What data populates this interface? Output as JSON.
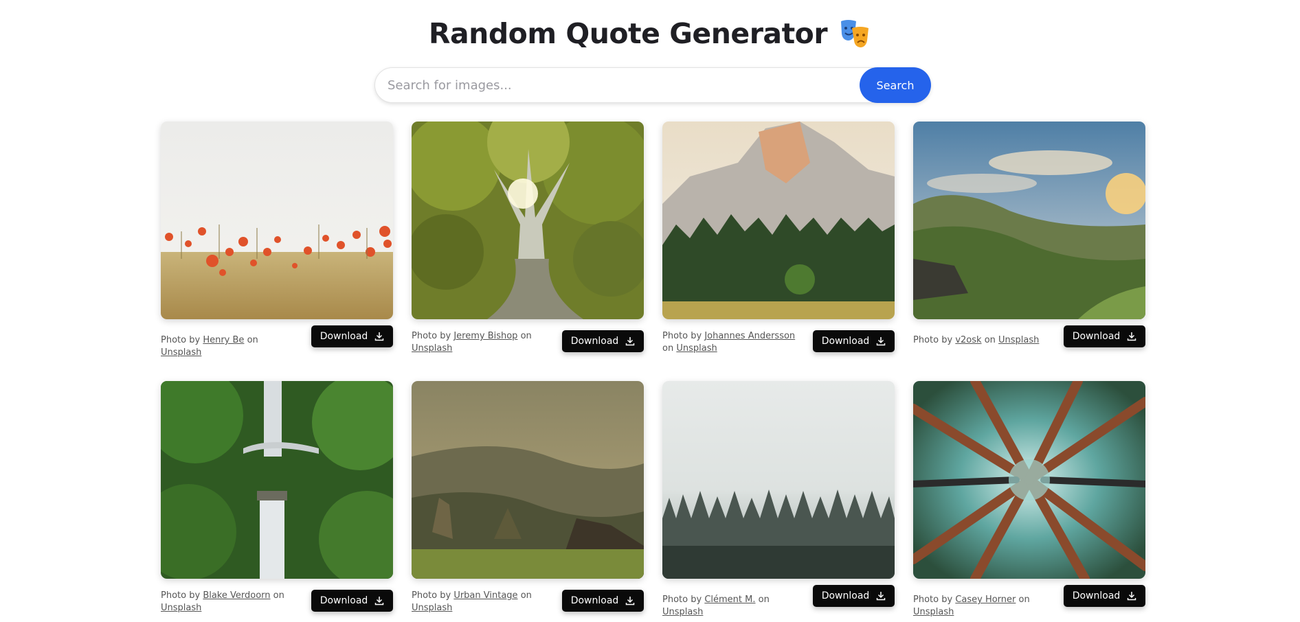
{
  "header": {
    "title": "Random Quote Generator",
    "icon": "theater-masks-icon"
  },
  "search": {
    "placeholder": "Search for images...",
    "value": "",
    "button_label": "Search",
    "button_color": "#2563eb"
  },
  "cards": [
    {
      "prefix": "Photo by",
      "author": "Henry Be",
      "on": "on",
      "source": "Unsplash",
      "download": "Download",
      "scene": "poppy-field"
    },
    {
      "prefix": "Photo by",
      "author": "Jeremy Bishop",
      "on": "on",
      "source": "Unsplash",
      "download": "Download",
      "scene": "big-tree"
    },
    {
      "prefix": "Photo by",
      "author": "Johannes Andersson",
      "on": "on",
      "source": "Unsplash",
      "download": "Download",
      "scene": "granite-mountain"
    },
    {
      "prefix": "Photo by",
      "author": "v2osk",
      "on": "on",
      "source": "Unsplash",
      "download": "Download",
      "scene": "green-valley"
    },
    {
      "prefix": "Photo by",
      "author": "Blake Verdoorn",
      "on": "on",
      "source": "Unsplash",
      "download": "Download",
      "scene": "waterfall"
    },
    {
      "prefix": "Photo by",
      "author": "Urban Vintage",
      "on": "on",
      "source": "Unsplash",
      "download": "Download",
      "scene": "misty-hills"
    },
    {
      "prefix": "Photo by",
      "author": "Clément M.",
      "on": "on",
      "source": "Unsplash",
      "download": "Download",
      "scene": "foggy-forest"
    },
    {
      "prefix": "Photo by",
      "author": "Casey Horner",
      "on": "on",
      "source": "Unsplash",
      "download": "Download",
      "scene": "redwood-canopy"
    }
  ]
}
